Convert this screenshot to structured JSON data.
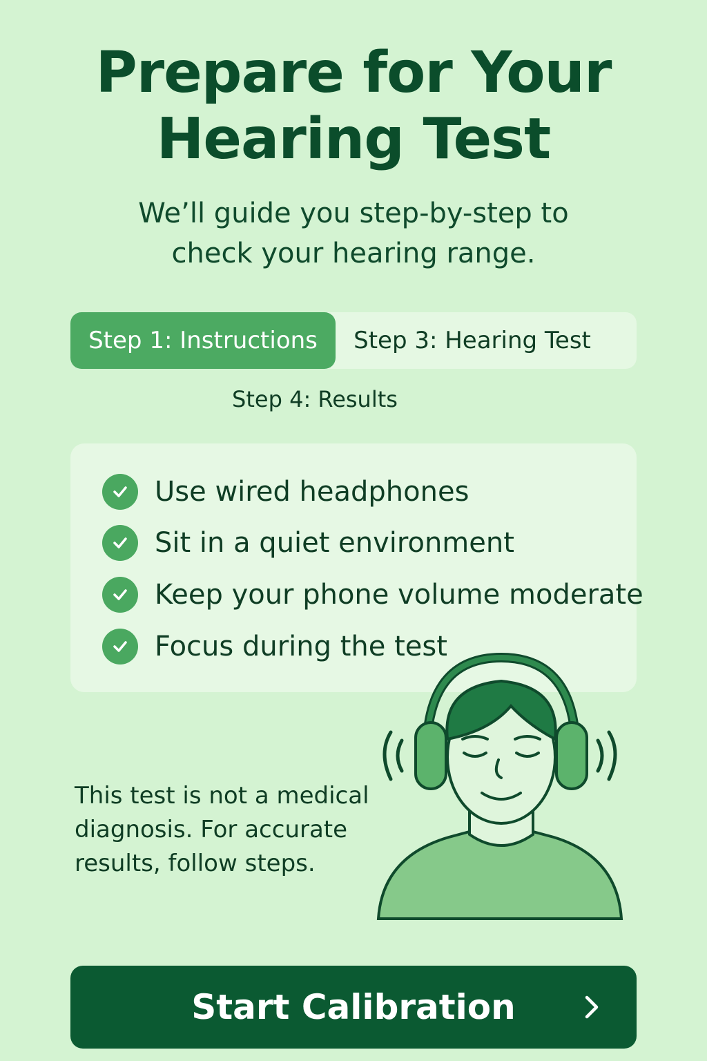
{
  "header": {
    "title_line1": "Prepare for Your",
    "title_line2": "Hearing Test",
    "subtitle_line1": "We’ll guide you step-by-step to",
    "subtitle_line2": "check your hearing range."
  },
  "steps": {
    "active": "Step 1:  Instructions",
    "step3": "Step 3:  Hearing Test",
    "step4": "Step 4:  Results"
  },
  "checklist": {
    "items": [
      "Use wired headphones",
      "Sit in a quiet environment",
      "Keep your phone volume moderate",
      "Focus during the test"
    ],
    "icon": "check-circle-icon"
  },
  "disclaimer": {
    "line1": "This test is not a medical",
    "line2": "diagnosis. For accurate",
    "line3": "results, follow steps."
  },
  "cta": {
    "label": "Start Calibration",
    "icon": "chevron-right-icon"
  },
  "colors": {
    "background": "#d4f3d2",
    "accent": "#4caa62",
    "primary_dark": "#0b5a32",
    "text": "#0f3d24"
  }
}
